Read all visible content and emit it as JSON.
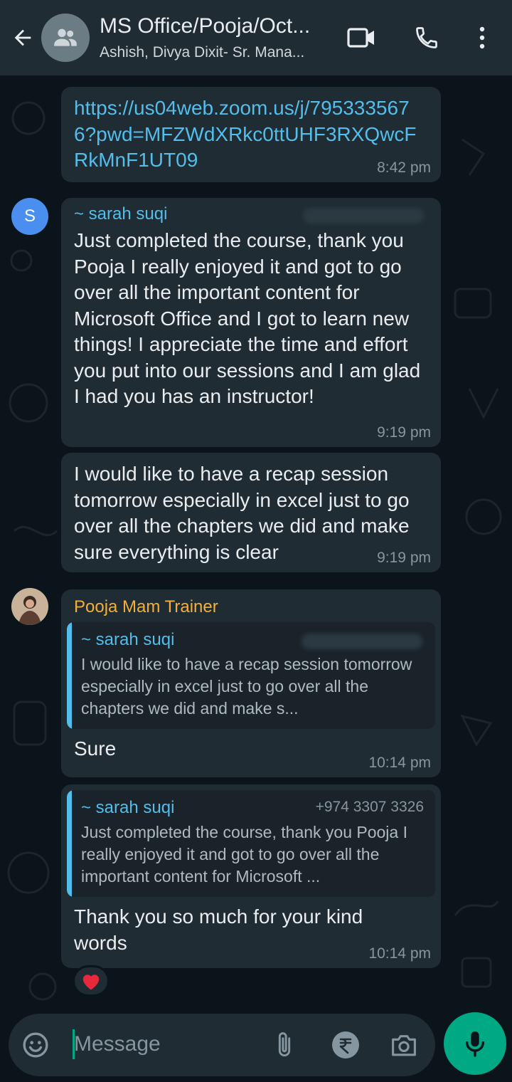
{
  "header": {
    "title": "MS Office/Pooja/Oct...",
    "subtitle": "Ashish, Divya Dixit- Sr. Mana..."
  },
  "messages": [
    {
      "type": "link",
      "text": "https://us04web.zoom.us/j/7953335676?pwd=MFZWdXRkc0ttUHF3RXQwcFRkMnF1UT09",
      "time": "8:42 pm"
    },
    {
      "sender": "~ sarah suqi",
      "avatar_letter": "S",
      "text": "Just completed the course, thank you Pooja I really enjoyed it and got to go over all the important content for Microsoft Office and I got to learn new things! I appreciate the time and effort you put into our sessions and I am glad I had you has an instructor!",
      "time": "9:19 pm"
    },
    {
      "text": "I would like to have a recap session tomorrow especially in excel just to go over all the chapters we did and make sure everything is clear",
      "time": "9:19 pm"
    },
    {
      "sender": "Pooja Mam Trainer",
      "quote": {
        "name": "~ sarah suqi",
        "text": "I would like to have a recap session tomorrow especially in excel just to go over all the chapters we did and make s..."
      },
      "text": "Sure",
      "time": "10:14 pm"
    },
    {
      "quote": {
        "name": "~ sarah suqi",
        "phone": "+974 3307 3326",
        "text": "Just completed the course, thank you Pooja I really enjoyed it and got to go over all the important content for Microsoft ..."
      },
      "text": "Thank you so much for your kind words",
      "time": "10:14 pm",
      "reaction": "❤️"
    }
  ],
  "composer": {
    "placeholder": "Message"
  },
  "colors": {
    "accent": "#00a884",
    "link": "#53bdeb",
    "sender_pooja": "#f2b03a",
    "bubble": "#202c33",
    "header": "#1f2c34"
  },
  "icons": [
    "back-arrow-icon",
    "group-icon",
    "video-call-icon",
    "phone-icon",
    "more-vert-icon",
    "emoji-icon",
    "attach-icon",
    "rupee-icon",
    "camera-icon",
    "mic-icon",
    "heart-icon"
  ]
}
